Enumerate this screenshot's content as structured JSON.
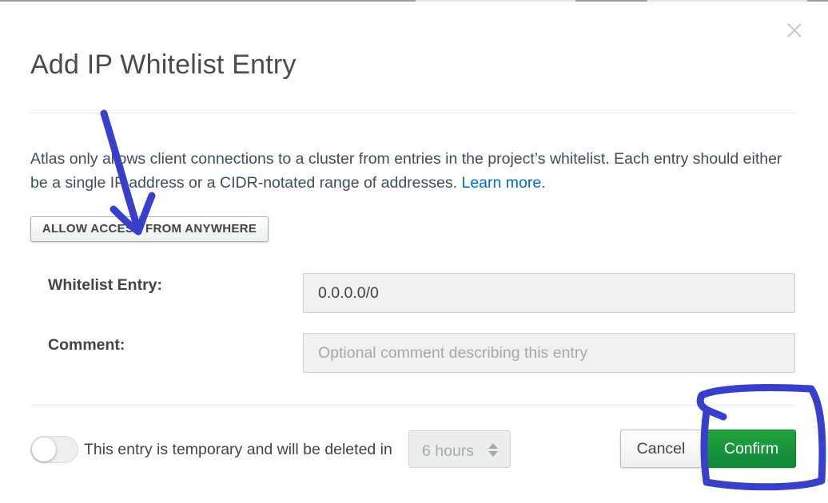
{
  "dialog": {
    "title": "Add IP Whitelist Entry",
    "description": "Atlas only allows client connections to a cluster from entries in the project’s whitelist. Each entry should either be a single IP address or a CIDR-notated range of addresses.",
    "learn_more": "Learn more.",
    "allow_anywhere_label": "ALLOW ACCESS FROM ANYWHERE"
  },
  "form": {
    "whitelist_entry": {
      "label": "Whitelist Entry:",
      "value": "0.0.0.0/0"
    },
    "comment": {
      "label": "Comment:",
      "value": "",
      "placeholder": "Optional comment describing this entry"
    }
  },
  "footer": {
    "temporary_toggle_on": false,
    "temporary_label": "This entry is temporary and will be deleted in",
    "duration_value": "6 hours",
    "cancel_label": "Cancel",
    "confirm_label": "Confirm"
  },
  "icons": {
    "close": "close-icon",
    "duration_arrows": "chevron-up-down-icon"
  },
  "colors": {
    "confirm": "#13aa52",
    "link": "#006cbc",
    "annotation_ink": "#3a3fc8",
    "input_background": "#f1f1f1"
  }
}
